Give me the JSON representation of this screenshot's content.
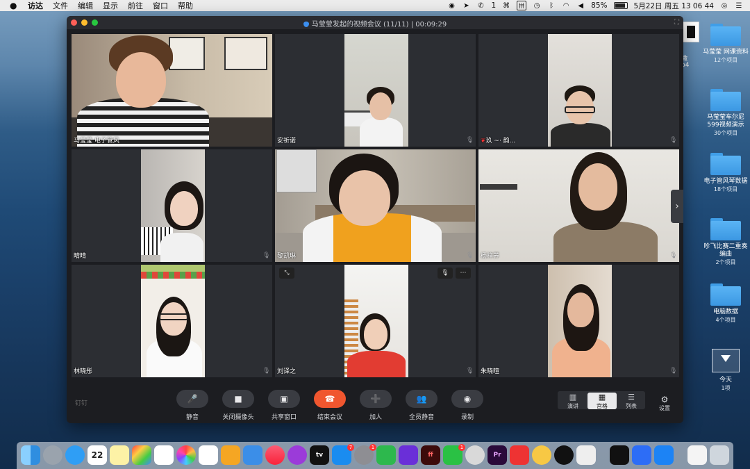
{
  "menubar": {
    "apple": "",
    "items": [
      "访达",
      "文件",
      "编辑",
      "显示",
      "前往",
      "窗口",
      "帮助"
    ],
    "status": {
      "battery": "85%",
      "datetime": "5月22日 周五  13 06 44",
      "wechat_count": "1",
      "input_method": "拼",
      "battery_level": 0.85
    }
  },
  "desktop": {
    "edge_text": [
      "微",
      "p4"
    ],
    "items": [
      {
        "label": "马莹莹 网课资料",
        "sub": "12个项目"
      },
      {
        "label": "马莹莹车尔尼599视频演示",
        "sub": "30个项目"
      },
      {
        "label": "电子管风琴数据",
        "sub": "18个项目"
      },
      {
        "label": "昣飞比赛二重奏编曲",
        "sub": "2个项目"
      },
      {
        "label": "电脑数据",
        "sub": "4个项目"
      },
      {
        "label": "今天",
        "sub": "1项"
      }
    ]
  },
  "window": {
    "title": "马莹莹发起的视频会议 (11/11) | 00:09:29",
    "participants": [
      {
        "name": "马莹莹 电子管风"
      },
      {
        "name": "安祈诺"
      },
      {
        "name": "玖 ~· 韵..."
      },
      {
        "name": "晴晴"
      },
      {
        "name": "黎凯琳"
      },
      {
        "name": "杨梓荞"
      },
      {
        "name": "林晓彤"
      },
      {
        "name": "刘译之"
      },
      {
        "name": "朱晓暄"
      }
    ],
    "brand": "钉钉",
    "controls": [
      {
        "label": "静音",
        "icon": "🎤"
      },
      {
        "label": "关闭摄像头",
        "icon": "■"
      },
      {
        "label": "共享窗口",
        "icon": "▣"
      },
      {
        "label": "结束会议",
        "icon": "☎"
      },
      {
        "label": "加人",
        "icon": "➕"
      },
      {
        "label": "全员静音",
        "icon": "👥"
      },
      {
        "label": "录制",
        "icon": "◉"
      }
    ],
    "views": [
      {
        "label": "演讲",
        "icon": "▥"
      },
      {
        "label": "宫格",
        "icon": "▦"
      },
      {
        "label": "列表",
        "icon": "☰"
      }
    ],
    "settings_label": "设置",
    "settings_icon": "⚙"
  },
  "dock": {
    "calendar_day": "22",
    "premiere_label": "Pr",
    "tv_label": "tv",
    "ff_label": "ff",
    "badges": [
      "7",
      "1",
      "1"
    ],
    "colors": {
      "finder": "#3aa0f0",
      "accent": "#f0562f"
    }
  }
}
